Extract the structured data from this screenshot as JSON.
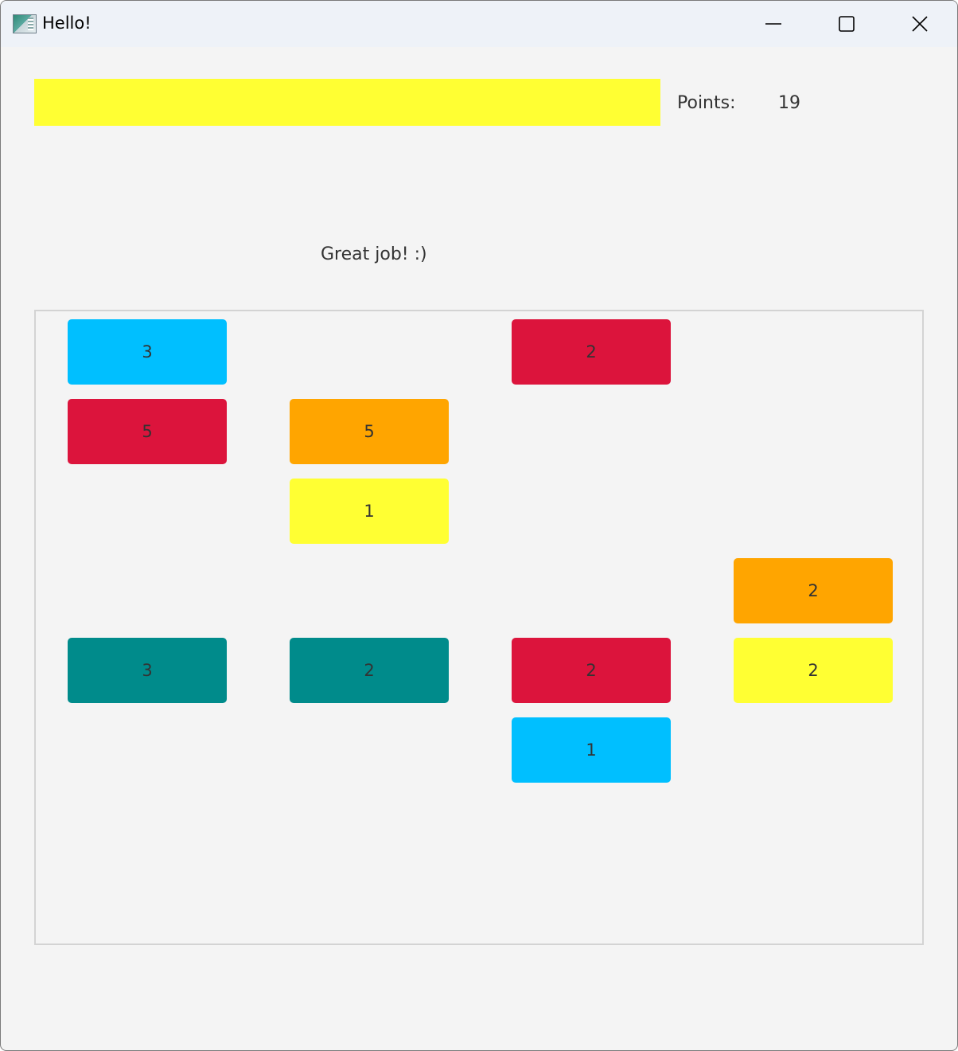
{
  "window": {
    "title": "Hello!",
    "icon": "app-window-icon",
    "controls": [
      "minimize-icon",
      "maximize-icon",
      "close-icon"
    ]
  },
  "progress": {
    "color": "#ffff33",
    "fraction": 1.0
  },
  "points": {
    "label": "Points:",
    "value": "19"
  },
  "message": "Great job! :)",
  "colors": {
    "cyan": "#00bfff",
    "red": "#dc143c",
    "orange": "#ffa500",
    "yellow": "#ffff33",
    "teal": "#008b8b"
  },
  "board": {
    "columns": 4,
    "rows": 7,
    "tiles": [
      {
        "col": 1,
        "row": 1,
        "color": "cyan",
        "value": "3"
      },
      {
        "col": 3,
        "row": 1,
        "color": "red",
        "value": "2"
      },
      {
        "col": 1,
        "row": 2,
        "color": "red",
        "value": "5"
      },
      {
        "col": 2,
        "row": 2,
        "color": "orange",
        "value": "5"
      },
      {
        "col": 2,
        "row": 3,
        "color": "yellow",
        "value": "1"
      },
      {
        "col": 4,
        "row": 4,
        "color": "orange",
        "value": "2"
      },
      {
        "col": 1,
        "row": 5,
        "color": "teal",
        "value": "3"
      },
      {
        "col": 2,
        "row": 5,
        "color": "teal",
        "value": "2"
      },
      {
        "col": 3,
        "row": 5,
        "color": "red",
        "value": "2"
      },
      {
        "col": 4,
        "row": 5,
        "color": "yellow",
        "value": "2"
      },
      {
        "col": 3,
        "row": 6,
        "color": "cyan",
        "value": "1"
      }
    ]
  }
}
